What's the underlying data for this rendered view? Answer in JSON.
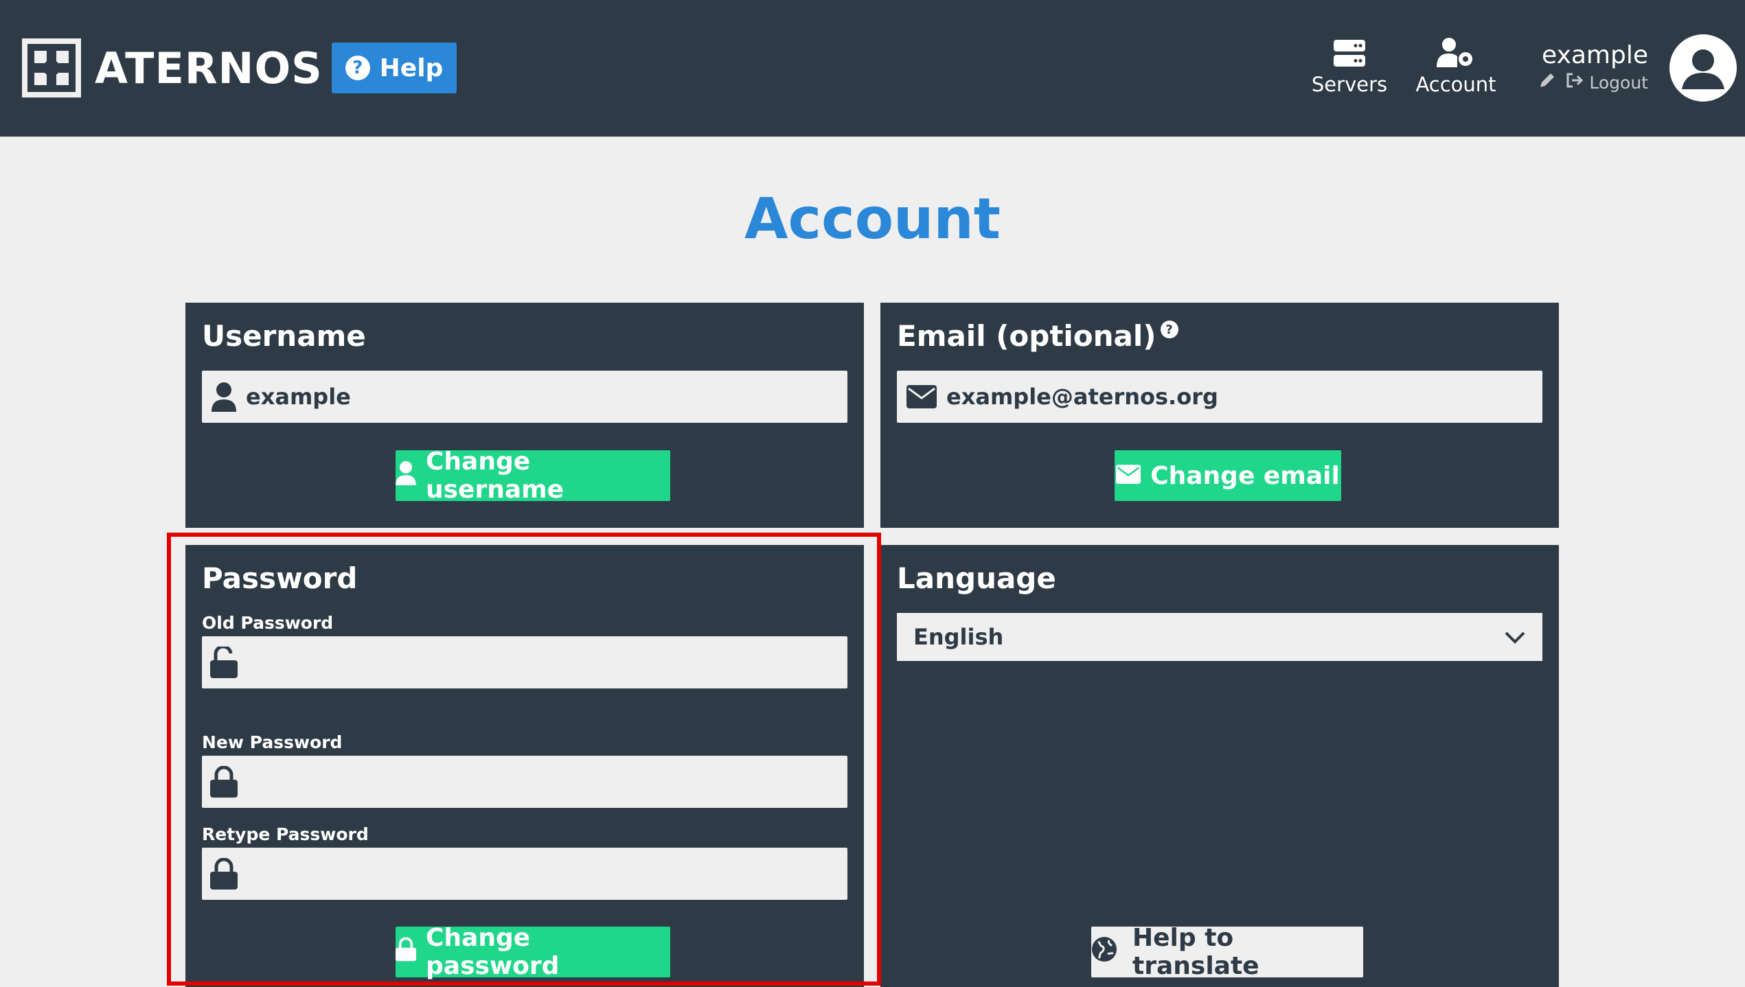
{
  "header": {
    "brand": "ATERNOS",
    "help_label": "Help",
    "nav": [
      {
        "label": "Servers",
        "icon": "servers-icon"
      },
      {
        "label": "Account",
        "icon": "account-settings-icon"
      }
    ],
    "user": {
      "name": "example",
      "logout_label": "Logout"
    }
  },
  "page": {
    "title": "Account"
  },
  "username_panel": {
    "title": "Username",
    "value": "example",
    "button_label": "Change username"
  },
  "email_panel": {
    "title": "Email (optional)",
    "value": "example@aternos.org",
    "button_label": "Change email"
  },
  "password_panel": {
    "title": "Password",
    "old_label": "Old Password",
    "new_label": "New Password",
    "retype_label": "Retype Password",
    "old_value": "",
    "new_value": "",
    "retype_value": "",
    "button_label": "Change password"
  },
  "language_panel": {
    "title": "Language",
    "selected": "English",
    "translate_label": "Help to translate"
  },
  "colors": {
    "header_bg": "#2e3a45",
    "accent_blue": "#2b87d8",
    "accent_green": "#20d68b",
    "highlight_red": "#e00000"
  }
}
